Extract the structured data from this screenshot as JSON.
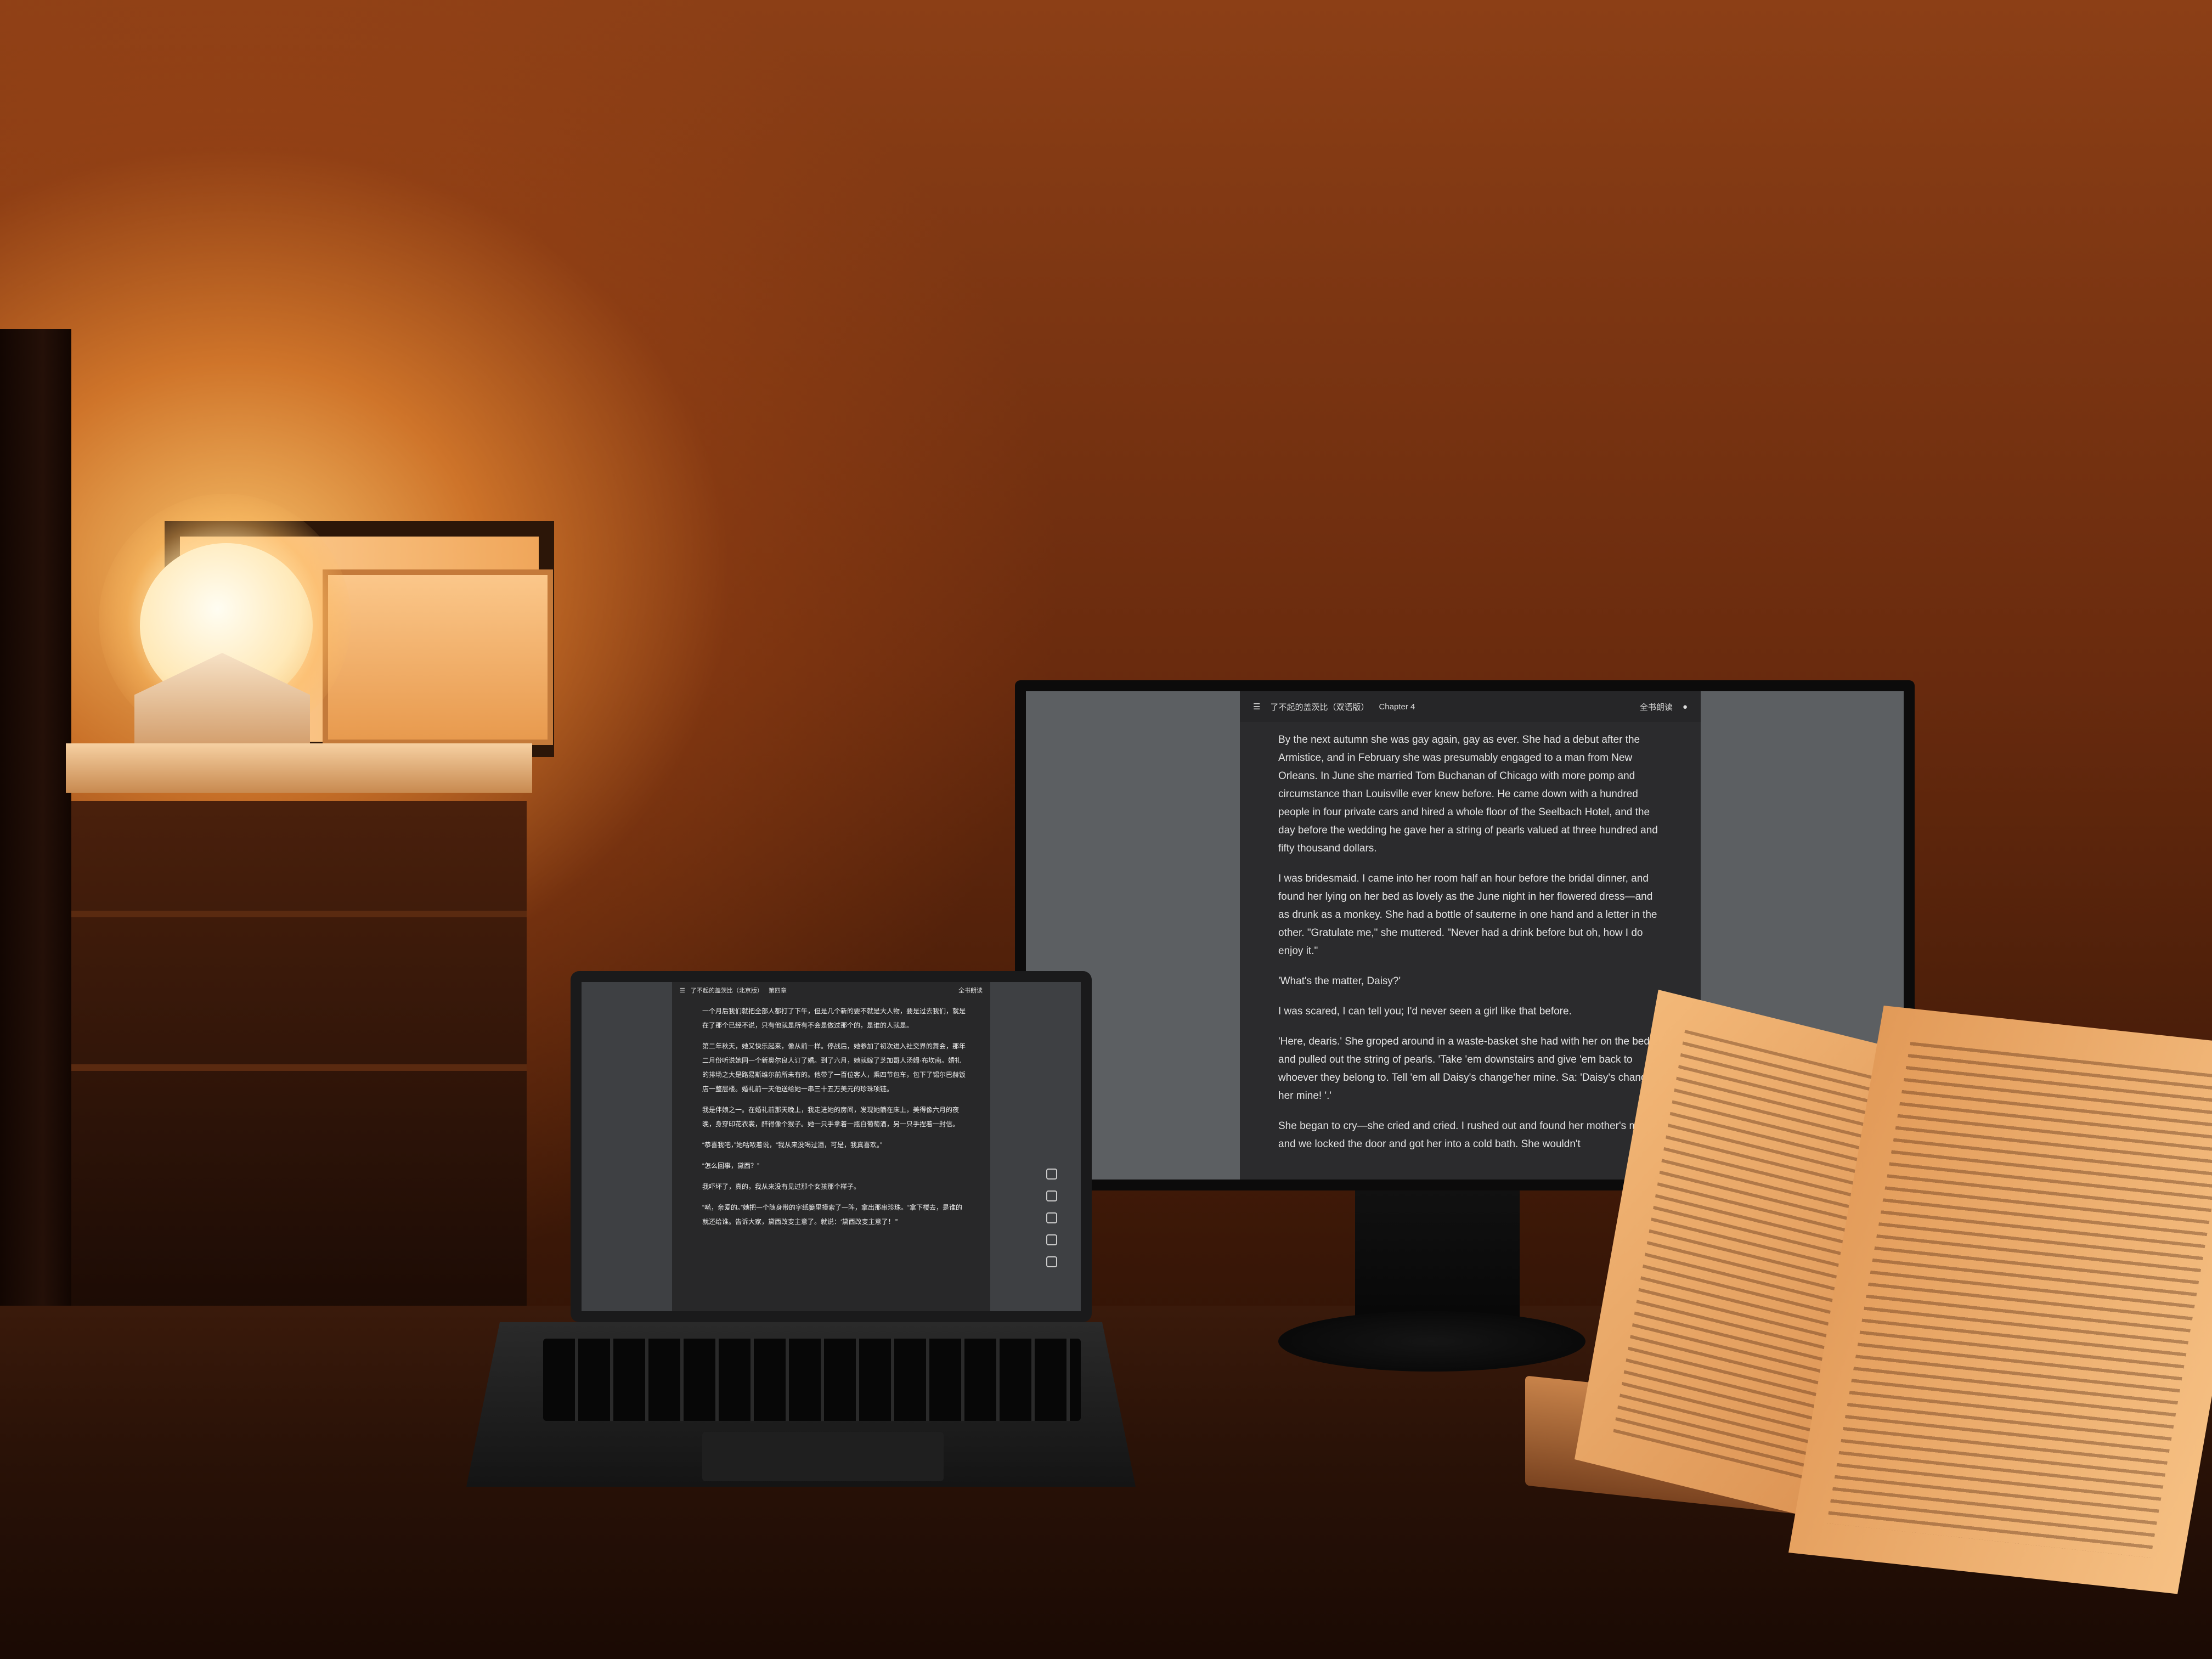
{
  "scene": {
    "monitor": {
      "title": "了不起的盖茨比（双语版）",
      "chapter": "Chapter 4",
      "mode": "全书朗读",
      "paragraphs": [
        "By the next autumn she was gay again, gay as ever. She had a debut after the Armistice, and in February she was presumably engaged to a man from New Orleans. In June she married Tom Buchanan of Chicago with more pomp and circumstance than Louisville ever knew before. He came down with a hundred people in four private cars and hired a whole floor of the Seelbach Hotel, and the day before the wedding he gave her a string of pearls valued at three hundred and fifty thousand dollars.",
        "I was bridesmaid. I came into her room half an hour before the bridal dinner, and found her lying on her bed as lovely as the June night in her flowered dress—and as drunk as a monkey. She had a bottle of sauterne in one hand and a letter in the other. \"Gratulate me,\" she muttered. \"Never had a drink before but oh, how I do enjoy it.\"",
        "'What's the matter, Daisy?'",
        "I was scared, I can tell you; I'd never seen a girl like that before.",
        "'Here, dearis.' She groped around in a waste-basket she had with her on the bed and pulled out the string of pearls. 'Take 'em downstairs and give 'em back to whoever they belong to. Tell 'em all Daisy's change'her mine. Sa: 'Daisy's change' her mine! '.'",
        "She began to cry—she cried and cried. I rushed out and found her mother's maid and we locked the door and got her into a cold bath. She wouldn't"
      ]
    },
    "laptop": {
      "title": "了不起的盖茨比（北京版）",
      "chapter": "第四章",
      "mode": "全书朗读",
      "paragraphs": [
        "一个月后我们就把全部人都打了下午，但是几个新的要不就是大人物，要是过去我们，就是在了那个已经不说，只有他就是所有不会是做过那个的，是谁的人就是。",
        "第二年秋天，她又快乐起来，像从前一样。停战后，她参加了初次进入社交界的舞会，那年二月份听说她同一个新奥尔良人订了婚。到了六月，她就嫁了芝加哥人汤姆·布坎南。婚礼的排场之大是路易斯维尔前所未有的。他带了一百位客人，乘四节包车，包下了锡尔巴赫饭店一整层楼。婚礼前一天他送给她一串三十五万美元的珍珠项链。",
        "我是伴娘之一。在婚礼前那天晚上，我走进她的房间，发现她躺在床上，美得像六月的夜晚，身穿印花衣裳，醉得像个猴子。她一只手拿着一瓶白葡萄酒，另一只手捏着一封信。",
        "“恭喜我吧，”她咕哝着说，“我从来没喝过酒，可是，我真喜欢。”",
        "“怎么回事，黛西？”",
        "我吓坏了，真的，我从来没有见过那个女孩那个样子。",
        "“喏，亲爱的。”她把一个随身带的字纸篓里摸索了一阵，拿出那串珍珠。“拿下楼去，是谁的就还给谁。告诉大家，黛西改变主意了。就说：‘黛西改变主意了！’”"
      ],
      "side_icons": [
        "list-icon",
        "bookmark-icon",
        "font-icon",
        "settings-icon",
        "phone-icon"
      ]
    }
  }
}
